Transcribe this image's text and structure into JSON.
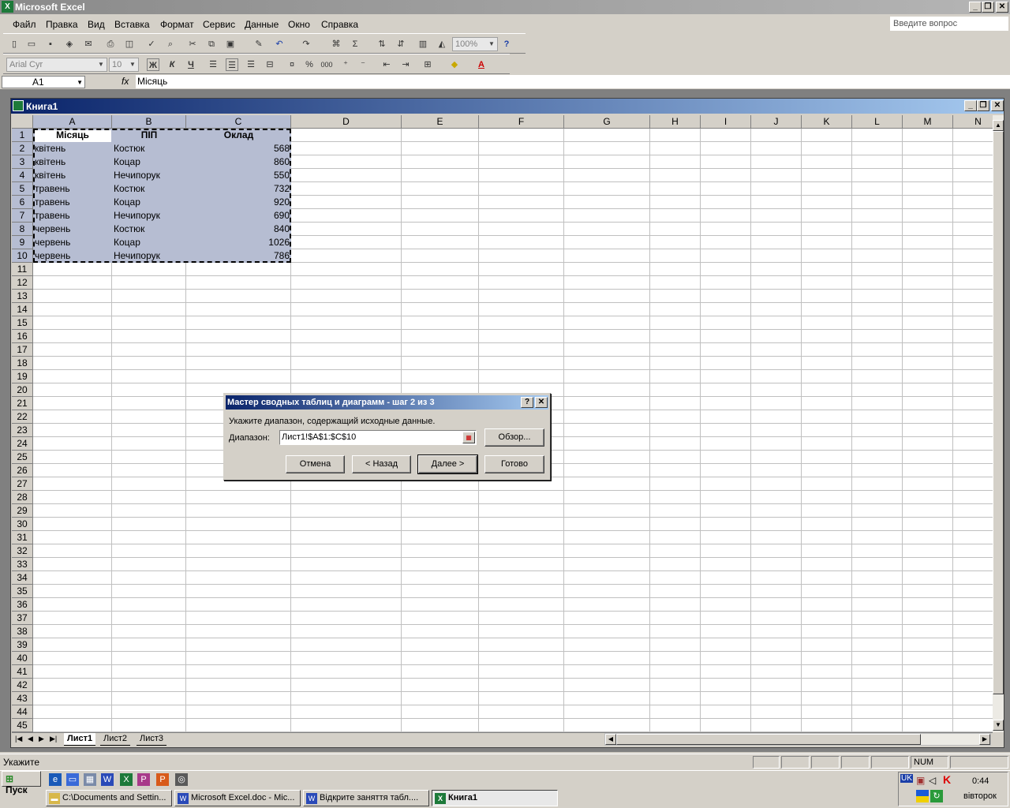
{
  "app": {
    "title": "Microsoft Excel"
  },
  "menu": [
    "Файл",
    "Правка",
    "Вид",
    "Вставка",
    "Формат",
    "Сервис",
    "Данные",
    "Окно",
    "Справка"
  ],
  "ask_placeholder": "Введите вопрос",
  "toolbar": {
    "zoom": "100%",
    "font": "Arial Cyr",
    "size": "10",
    "bold": "Ж",
    "italic": "К",
    "underline": "Ч",
    "percent": "%",
    "thousands": "000"
  },
  "formula_bar": {
    "name_box": "A1",
    "fx": "fx",
    "value": "Місяць"
  },
  "workbook": {
    "title": "Книга1"
  },
  "columns": [
    "A",
    "B",
    "C",
    "D",
    "E",
    "F",
    "G",
    "H",
    "I",
    "J",
    "K",
    "L",
    "M",
    "N"
  ],
  "table": {
    "headers": [
      "Місяць",
      "ПІП",
      "Оклад"
    ],
    "rows": [
      [
        "квітень",
        "Костюк",
        "568"
      ],
      [
        "квітень",
        "Коцар",
        "860"
      ],
      [
        "квітень",
        "Нечипорук",
        "550"
      ],
      [
        "травень",
        "Костюк",
        "732"
      ],
      [
        "травень",
        "Коцар",
        "920"
      ],
      [
        "травень",
        "Нечипорук",
        "690"
      ],
      [
        "червень",
        "Костюк",
        "840"
      ],
      [
        "червень",
        "Коцар",
        "1026"
      ],
      [
        "червень",
        "Нечипорук",
        "786"
      ]
    ]
  },
  "row_count": 45,
  "sheets": [
    "Лист1",
    "Лист2",
    "Лист3"
  ],
  "dialog": {
    "title": "Мастер сводных таблиц и диаграмм - шаг 2 из 3",
    "prompt": "Укажите диапазон, содержащий исходные данные.",
    "range_label": "Диапазон:",
    "range_value": "Лист1!$A$1:$C$10",
    "browse": "Обзор...",
    "cancel": "Отмена",
    "back": "< Назад",
    "next": "Далее >",
    "finish": "Готово"
  },
  "status": {
    "text": "Укажите",
    "num": "NUM"
  },
  "taskbar": {
    "start": "Пуск",
    "tasks": [
      "C:\\Documents and Settin...",
      "Microsoft Excel.doc - Mic...",
      "Відкрите заняття табл....",
      "Книга1"
    ],
    "lang": "UK",
    "time": "0:44",
    "day": "вівторок"
  },
  "colors": {
    "selection": "#b6bdd2",
    "title_grad_start": "#0a246a",
    "title_grad_end": "#a6caf0"
  }
}
